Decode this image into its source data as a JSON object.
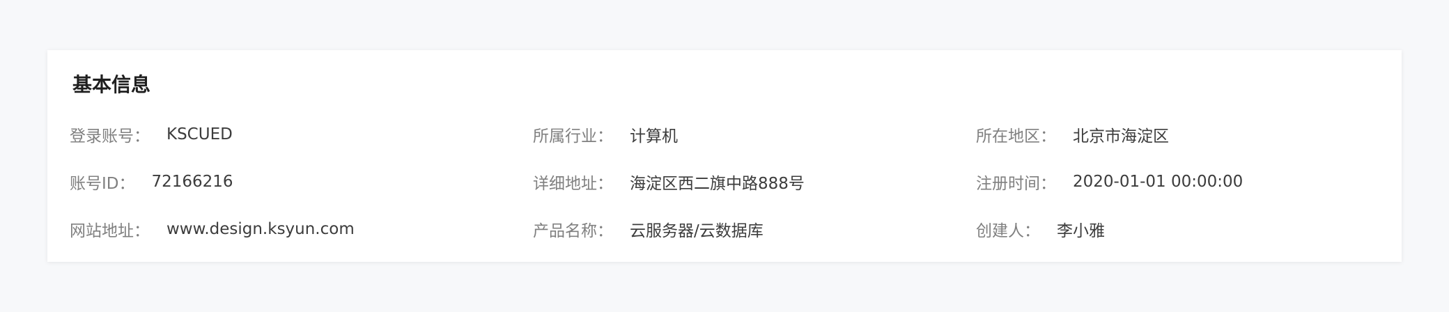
{
  "section": {
    "title": "基本信息"
  },
  "fields": [
    {
      "label": "登录账号：",
      "value": "KSCUED"
    },
    {
      "label": "所属行业：",
      "value": "计算机"
    },
    {
      "label": "所在地区：",
      "value": "北京市海淀区"
    },
    {
      "label": "账号ID：",
      "value": "72166216"
    },
    {
      "label": "详细地址：",
      "value": "海淀区西二旗中路888号"
    },
    {
      "label": "注册时间：",
      "value": "2020-01-01 00:00:00"
    },
    {
      "label": "网站地址：",
      "value": "www.design.ksyun.com"
    },
    {
      "label": "产品名称：",
      "value": "云服务器/云数据库"
    },
    {
      "label": "创建人：",
      "value": "李小雅"
    }
  ]
}
